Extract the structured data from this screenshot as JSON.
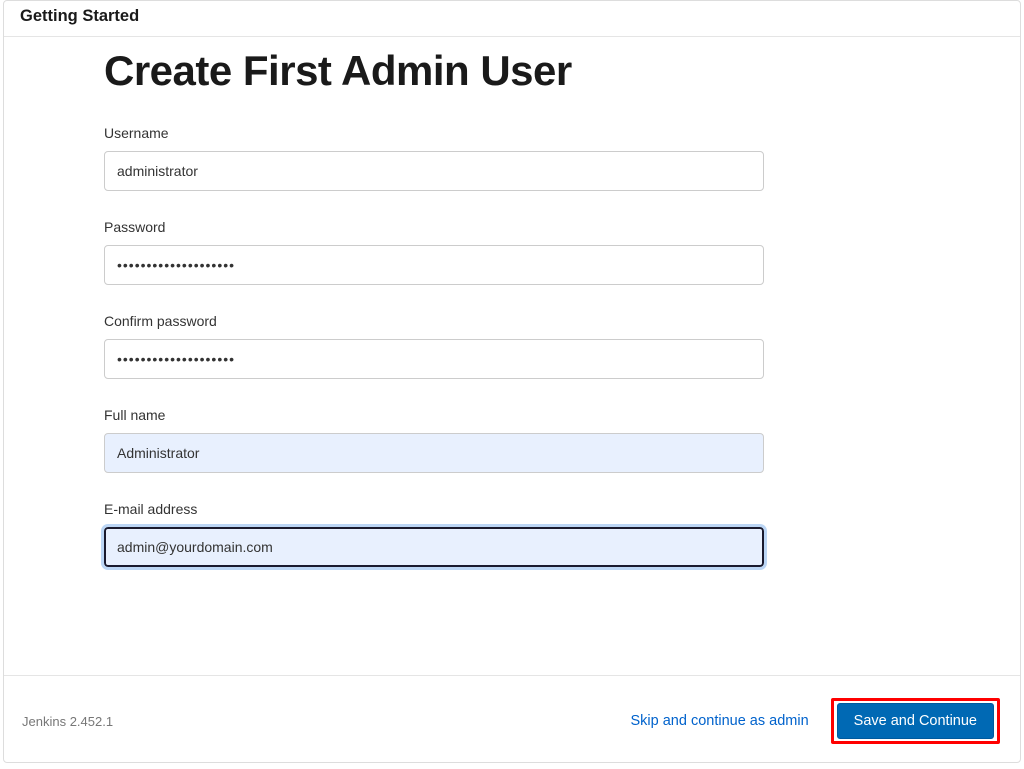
{
  "header": {
    "title": "Getting Started"
  },
  "page": {
    "title": "Create First Admin User"
  },
  "form": {
    "username": {
      "label": "Username",
      "value": "administrator"
    },
    "password": {
      "label": "Password",
      "value": "••••••••••••••••••••"
    },
    "confirm_password": {
      "label": "Confirm password",
      "value": "••••••••••••••••••••"
    },
    "full_name": {
      "label": "Full name",
      "value": "Administrator"
    },
    "email": {
      "label": "E-mail address",
      "value": "admin@yourdomain.com"
    }
  },
  "footer": {
    "version": "Jenkins 2.452.1",
    "skip_label": "Skip and continue as admin",
    "save_label": "Save and Continue"
  }
}
